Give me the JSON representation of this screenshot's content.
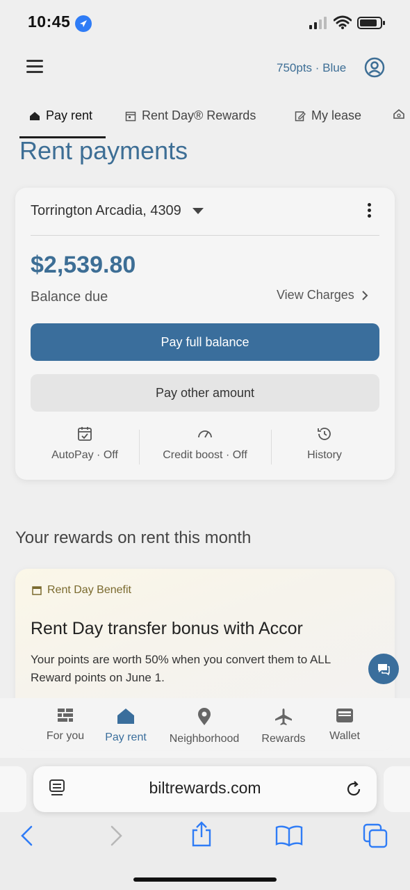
{
  "status": {
    "time": "10:45"
  },
  "header": {
    "points": "750pts · Blue"
  },
  "tabs": [
    {
      "label": "Pay rent",
      "icon": "home-icon"
    },
    {
      "label": "Rent Day® Rewards",
      "icon": "calendar-icon"
    },
    {
      "label": "My lease",
      "icon": "edit-doc-icon"
    }
  ],
  "page": {
    "title": "Rent payments"
  },
  "card": {
    "property": "Torrington Arcadia, 4309",
    "amount": "$2,539.80",
    "balance_label": "Balance due",
    "view_charges": "View Charges",
    "pay_full": "Pay full balance",
    "pay_other": "Pay other amount",
    "actions": [
      {
        "label": "AutoPay · Off",
        "icon": "calendar-check-icon"
      },
      {
        "label": "Credit boost · Off",
        "icon": "gauge-icon"
      },
      {
        "label": "History",
        "icon": "history-icon"
      }
    ]
  },
  "rewards": {
    "section_title": "Your rewards on rent this month",
    "tag": "Rent Day Benefit",
    "headline": "Rent Day transfer bonus with Accor",
    "body": "Your points are worth 50% when you convert them to ALL\nReward points on June 1."
  },
  "bottom_nav": [
    {
      "label": "For you",
      "icon": "grid-icon"
    },
    {
      "label": "Pay rent",
      "icon": "home-icon"
    },
    {
      "label": "Neighborhood",
      "icon": "map-pin-icon"
    },
    {
      "label": "Rewards",
      "icon": "plane-icon"
    },
    {
      "label": "Wallet",
      "icon": "wallet-icon"
    }
  ],
  "safari": {
    "url": "biltrewards.com"
  },
  "colors": {
    "accent": "#3a6e9c",
    "title_blue": "#3d6e95"
  }
}
